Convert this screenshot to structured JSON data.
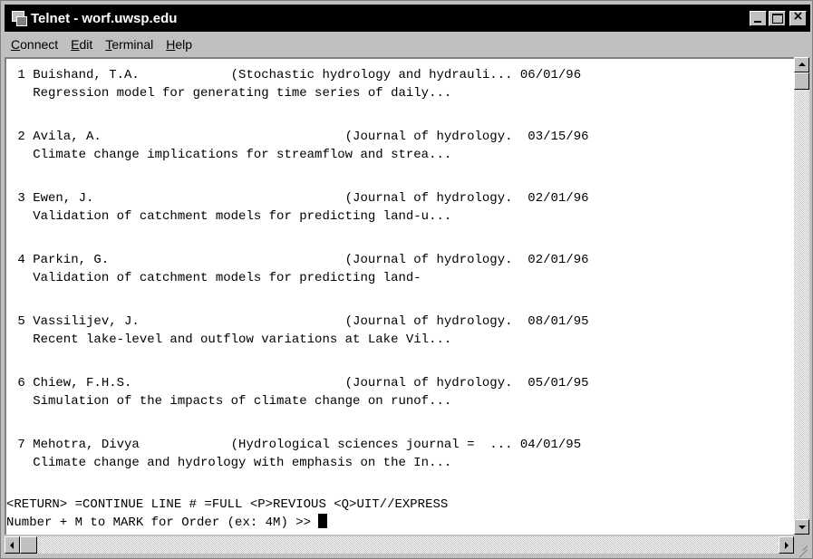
{
  "window": {
    "title": "Telnet - worf.uwsp.edu",
    "close_glyph": "×"
  },
  "menu": [
    {
      "accel": "C",
      "rest": "onnect"
    },
    {
      "accel": "E",
      "rest": "dit"
    },
    {
      "accel": "T",
      "rest": "erminal"
    },
    {
      "accel": "H",
      "rest": "elp"
    }
  ],
  "terminal": {
    "lines": [
      " 1 Buishand, T.A.            (Stochastic hydrology and hydrauli... 06/01/96",
      "   Regression model for generating time series of daily...",
      "",
      " 2 Avila, A.                                (Journal of hydrology.  03/15/96",
      "   Climate change implications for streamflow and strea...",
      "",
      " 3 Ewen, J.                                 (Journal of hydrology.  02/01/96",
      "   Validation of catchment models for predicting land-u...",
      "",
      " 4 Parkin, G.                               (Journal of hydrology.  02/01/96",
      "   Validation of catchment models for predicting land-",
      "",
      " 5 Vassilijev, J.                           (Journal of hydrology.  08/01/95",
      "   Recent lake-level and outflow variations at Lake Vil...",
      "",
      " 6 Chiew, F.H.S.                            (Journal of hydrology.  05/01/95",
      "   Simulation of the impacts of climate change on runof...",
      "",
      " 7 Mehotra, Divya            (Hydrological sciences journal =  ... 04/01/95",
      "   Climate change and hydrology with emphasis on the In...",
      "",
      "<RETURN> =CONTINUE LINE # =FULL <P>REVIOUS <Q>UIT//EXPRESS",
      "Number + M to MARK for Order (ex: 4M) >> "
    ]
  }
}
